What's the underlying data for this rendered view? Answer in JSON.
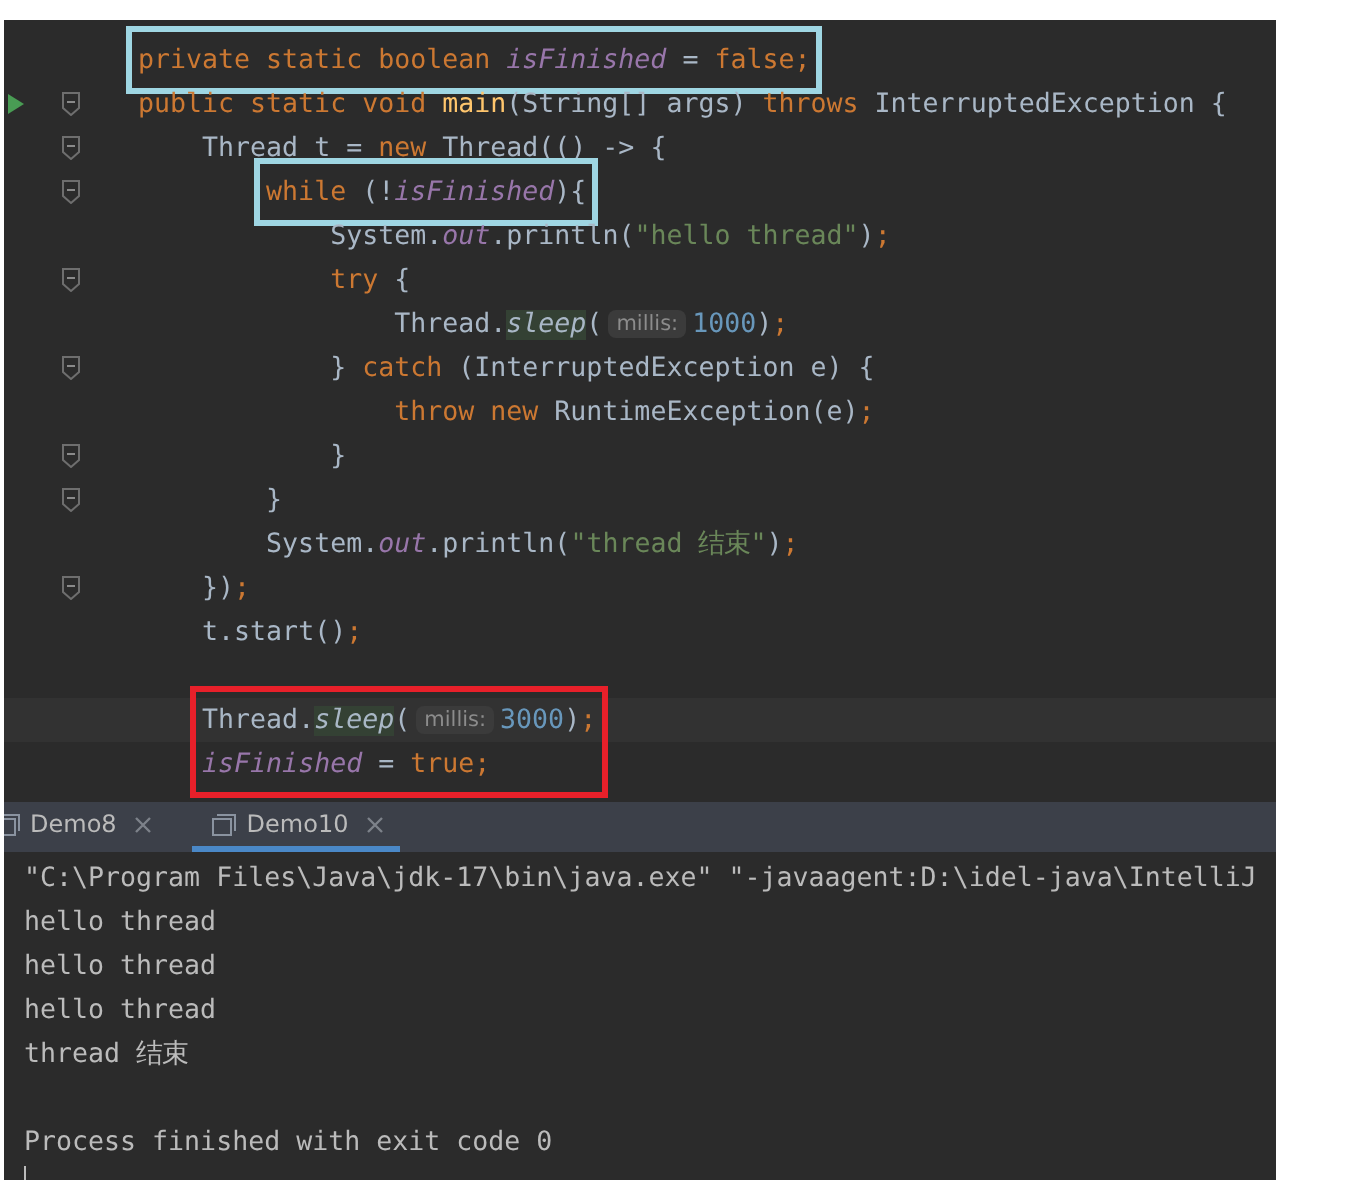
{
  "editor": {
    "lines": [
      {
        "run": false,
        "fold": false,
        "color": "#9fd6e3",
        "tokens": [
          {
            "kind": "keyword",
            "text": "private static boolean "
          },
          {
            "kind": "field",
            "text": "isFinished"
          },
          {
            "kind": "plain",
            "text": " = "
          },
          {
            "kind": "keyword",
            "text": "false;"
          }
        ]
      },
      {
        "run": true,
        "fold": true,
        "tokens": [
          {
            "kind": "keyword",
            "text": "public static void "
          },
          {
            "kind": "method",
            "text": "main"
          },
          {
            "kind": "plain",
            "text": "(String[] args) "
          },
          {
            "kind": "keyword",
            "text": "throws "
          },
          {
            "kind": "plain",
            "text": "InterruptedException {"
          }
        ]
      },
      {
        "run": false,
        "fold": true,
        "tokens": [
          {
            "kind": "plain",
            "text": "    Thread t = "
          },
          {
            "kind": "keyword",
            "text": "new "
          },
          {
            "kind": "plain",
            "text": "Thread(() -> {"
          }
        ]
      },
      {
        "run": false,
        "fold": true,
        "color": "#9fd6e3",
        "tokens": [
          {
            "kind": "keyword",
            "text": "        while "
          },
          {
            "kind": "plain",
            "text": "(!"
          },
          {
            "kind": "field",
            "text": "isFinished"
          },
          {
            "kind": "plain",
            "text": "){"
          }
        ]
      },
      {
        "run": false,
        "fold": false,
        "tokens": [
          {
            "kind": "plain",
            "text": "            System."
          },
          {
            "kind": "field",
            "text": "out"
          },
          {
            "kind": "plain",
            "text": ".println("
          },
          {
            "kind": "string",
            "text": "\"hello thread\""
          },
          {
            "kind": "plain",
            "text": ")"
          },
          {
            "kind": "keyword",
            "text": ";"
          }
        ]
      },
      {
        "run": false,
        "fold": true,
        "tokens": [
          {
            "kind": "keyword",
            "text": "            try "
          },
          {
            "kind": "plain",
            "text": "{"
          }
        ]
      },
      {
        "run": false,
        "fold": false,
        "tokens": [
          {
            "kind": "plain",
            "text": "                Thread."
          },
          {
            "kind": "static_call",
            "text": "sleep"
          },
          {
            "kind": "plain",
            "text": "("
          },
          {
            "kind": "hint",
            "text": "millis:"
          },
          {
            "kind": "number",
            "text": "1000"
          },
          {
            "kind": "plain",
            "text": ")"
          },
          {
            "kind": "keyword",
            "text": ";"
          }
        ]
      },
      {
        "run": false,
        "fold": true,
        "tokens": [
          {
            "kind": "plain",
            "text": "            } "
          },
          {
            "kind": "keyword",
            "text": "catch "
          },
          {
            "kind": "plain",
            "text": "(InterruptedException e) {"
          }
        ]
      },
      {
        "run": false,
        "fold": false,
        "tokens": [
          {
            "kind": "keyword",
            "text": "                throw new "
          },
          {
            "kind": "plain",
            "text": "RuntimeException(e)"
          },
          {
            "kind": "keyword",
            "text": ";"
          }
        ]
      },
      {
        "run": false,
        "fold": true,
        "tokens": [
          {
            "kind": "plain",
            "text": "            }"
          }
        ]
      },
      {
        "run": false,
        "fold": true,
        "tokens": [
          {
            "kind": "plain",
            "text": "        }"
          }
        ]
      },
      {
        "run": false,
        "fold": false,
        "tokens": [
          {
            "kind": "plain",
            "text": "        System."
          },
          {
            "kind": "field",
            "text": "out"
          },
          {
            "kind": "plain",
            "text": ".println("
          },
          {
            "kind": "string",
            "text": "\"thread 结束\""
          },
          {
            "kind": "plain",
            "text": ")"
          },
          {
            "kind": "keyword",
            "text": ";"
          }
        ]
      },
      {
        "run": false,
        "fold": true,
        "tokens": [
          {
            "kind": "plain",
            "text": "    })"
          },
          {
            "kind": "keyword",
            "text": ";"
          }
        ]
      },
      {
        "run": false,
        "fold": false,
        "tokens": [
          {
            "kind": "plain",
            "text": "    t.start()"
          },
          {
            "kind": "keyword",
            "text": ";"
          }
        ]
      },
      {
        "run": false,
        "fold": false
      },
      {
        "run": false,
        "fold": false,
        "current": true,
        "color": "#e8202a",
        "tokens": [
          {
            "kind": "plain",
            "text": "    Thread."
          },
          {
            "kind": "static_call",
            "text": "sleep"
          },
          {
            "kind": "plain",
            "text": "("
          },
          {
            "kind": "hint",
            "text": "millis:"
          },
          {
            "kind": "number",
            "text": "3000"
          },
          {
            "kind": "plain",
            "text": ")"
          },
          {
            "kind": "keyword",
            "text": ";"
          }
        ]
      },
      {
        "run": false,
        "fold": false,
        "color": "#e8202a",
        "tokens": [
          {
            "kind": "field",
            "text": "    isFinished"
          },
          {
            "kind": "plain",
            "text": " = "
          },
          {
            "kind": "keyword",
            "text": "true;"
          }
        ]
      }
    ]
  },
  "run_tabs": [
    {
      "label": "Demo8",
      "selected": false
    },
    {
      "label": "Demo10",
      "selected": true
    }
  ],
  "console": {
    "lines": [
      "\"C:\\Program Files\\Java\\jdk-17\\bin\\java.exe\" \"-javaagent:D:\\idel-java\\IntelliJ",
      "hello thread",
      "hello thread",
      "hello thread",
      "thread 结束"
    ],
    "exit_message": "Process finished with exit code 0"
  }
}
